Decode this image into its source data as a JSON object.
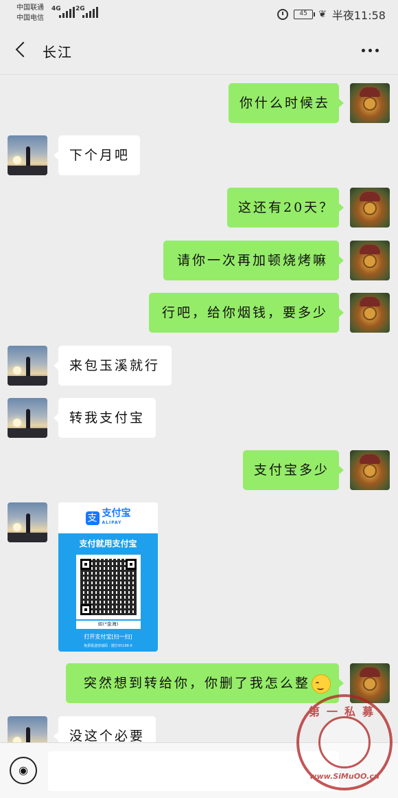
{
  "status_bar": {
    "carrier1": "中国联通",
    "carrier2": "中国电信",
    "net1": "4G",
    "net2": "2G",
    "battery": "45",
    "time": "半夜11:58"
  },
  "header": {
    "title": "长江"
  },
  "messages": [
    {
      "side": "right",
      "text": "你什么时候去"
    },
    {
      "side": "left",
      "text": "下个月吧"
    },
    {
      "side": "right",
      "text": "这还有20天？"
    },
    {
      "side": "right",
      "text": "请你一次再加顿烧烤嘛"
    },
    {
      "side": "right",
      "text": "行吧，给你烟钱，要多少"
    },
    {
      "side": "left",
      "text": "来包玉溪就行"
    },
    {
      "side": "left",
      "text": "转我支付宝"
    },
    {
      "side": "right",
      "text": "支付宝多少"
    },
    {
      "side": "right",
      "text": "突然想到转给你，你删了我怎么整"
    },
    {
      "side": "left",
      "text": "没这个必要"
    }
  ],
  "alipay_card": {
    "brand": "支付宝",
    "brand_en": "ALIPAY",
    "headline": "支付就用支付宝",
    "name": "如(*金海)",
    "cta": "打开支付宝[扫一扫]",
    "footer": "免费看送收钱码 · 拨打95188-6"
  },
  "watermark": {
    "cn": "第一私募",
    "en": "www.SiMuOO.cn"
  },
  "icons": {
    "back": "back-chevron-icon",
    "more": "more-dots-icon",
    "voice": "voice-input-icon"
  },
  "colors": {
    "background": "#ededed",
    "sent_bubble": "#95ec69",
    "received_bubble": "#ffffff",
    "alipay_blue": "#1fa0ec"
  }
}
